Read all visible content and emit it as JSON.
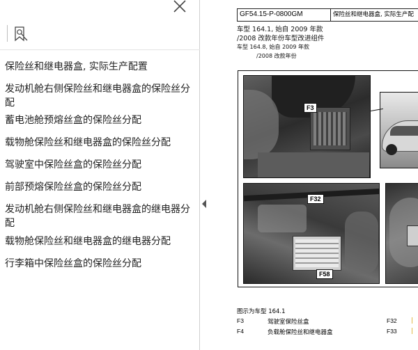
{
  "bookmarks": {
    "items": [
      {
        "label": "保险丝和继电器盒, 实际生产配置"
      },
      {
        "label": "发动机舱右侧保险丝和继电器盒的保险丝分配"
      },
      {
        "label": "蓄电池舱预熔丝盒的保险丝分配"
      },
      {
        "label": "载物舱保险丝和继电器盒的保险丝分配"
      },
      {
        "label": "驾驶室中保险丝盒的保险丝分配"
      },
      {
        "label": "前部预熔保险丝盒的保险丝分配"
      },
      {
        "label": "发动机舱右侧保险丝和继电器盒的继电器分配"
      },
      {
        "label": "载物舱保险丝和继电器盒的继电器分配"
      },
      {
        "label": "行李箱中保险丝盒的保险丝分配"
      }
    ]
  },
  "document": {
    "header_code": "GF54.15-P-0800GM",
    "header_title": "保险丝和继电器盒, 实际生产配",
    "line1": "车型  164.1, 始自 2009 年款",
    "line2": "/2008 改款年份车型改进组件",
    "line3": "车型   164.8, 始自 2009 年款",
    "line4": "/2008 改款年份",
    "figure_labels": {
      "f3": "F3",
      "f32": "F32",
      "f58": "F58"
    },
    "caption_title": "图示为车型 164.1",
    "legend": [
      {
        "code": "F3",
        "desc": "驾驶室保险丝盒",
        "code2": "F32"
      },
      {
        "code": "F4",
        "desc": "负载舱保险丝和继电器盒",
        "code2": "F33"
      }
    ]
  },
  "colors": {
    "accent_mark": "#d4a100"
  }
}
